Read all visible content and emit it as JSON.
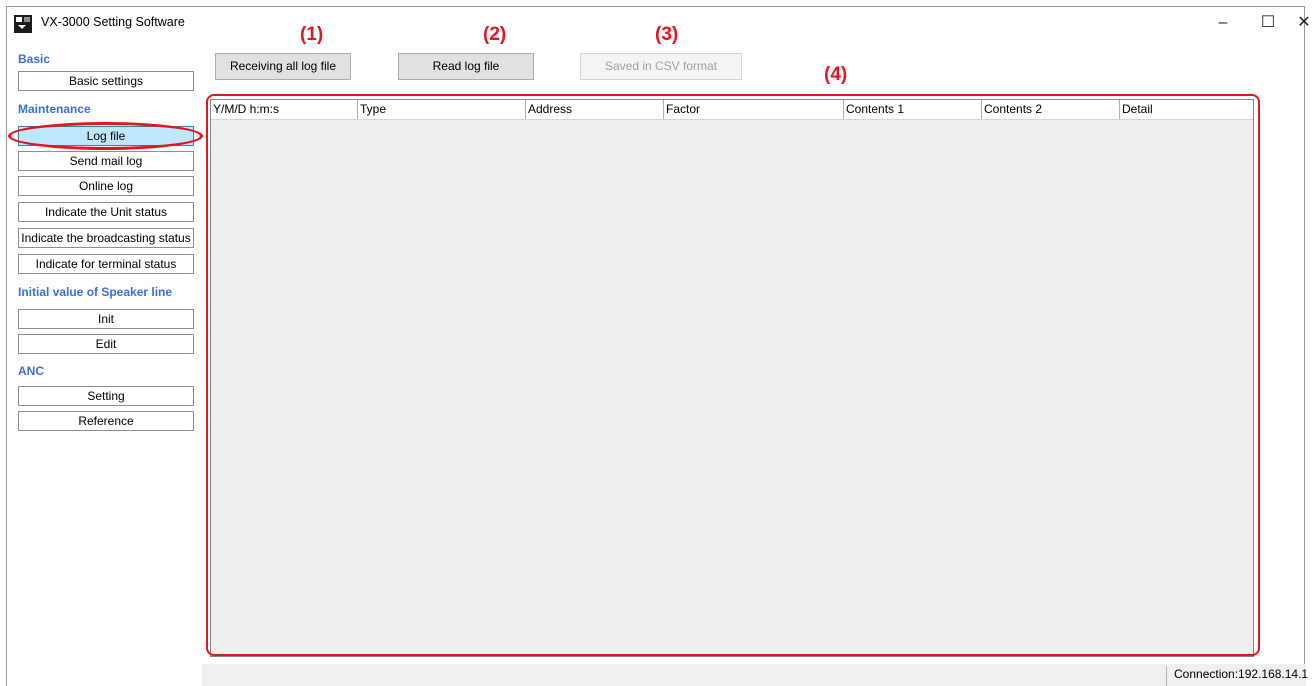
{
  "window": {
    "title": "VX-3000 Setting Software"
  },
  "sidebar": {
    "sections": {
      "basic": "Basic",
      "maintenance": "Maintenance",
      "speaker": "Initial value of Speaker line",
      "anc": "ANC"
    },
    "buttons": {
      "basic_settings": "Basic settings",
      "log_file": "Log file",
      "send_mail_log": "Send mail log",
      "online_log": "Online log",
      "unit_status": "Indicate the Unit status",
      "broadcasting_status": "Indicate the broadcasting status",
      "terminal_status": "Indicate for terminal status",
      "init": "Init",
      "edit": "Edit",
      "setting": "Setting",
      "reference": "Reference"
    }
  },
  "toolbar": {
    "receive_all": "Receiving all log file",
    "read_log": "Read log file",
    "save_csv": "Saved in CSV format"
  },
  "annotations": [
    "(1)",
    "(2)",
    "(3)",
    "(4)"
  ],
  "table": {
    "columns": [
      "Y/M/D h:m:s",
      "Type",
      "Address",
      "Factor",
      "Contents 1",
      "Contents 2",
      "Detail"
    ]
  },
  "status_bar": {
    "connection": "Connection:192.168.14.1"
  },
  "colors": {
    "section_label": "#3c6edc",
    "annotation_red": "#e2161e",
    "active_button": "#bee6fd"
  }
}
